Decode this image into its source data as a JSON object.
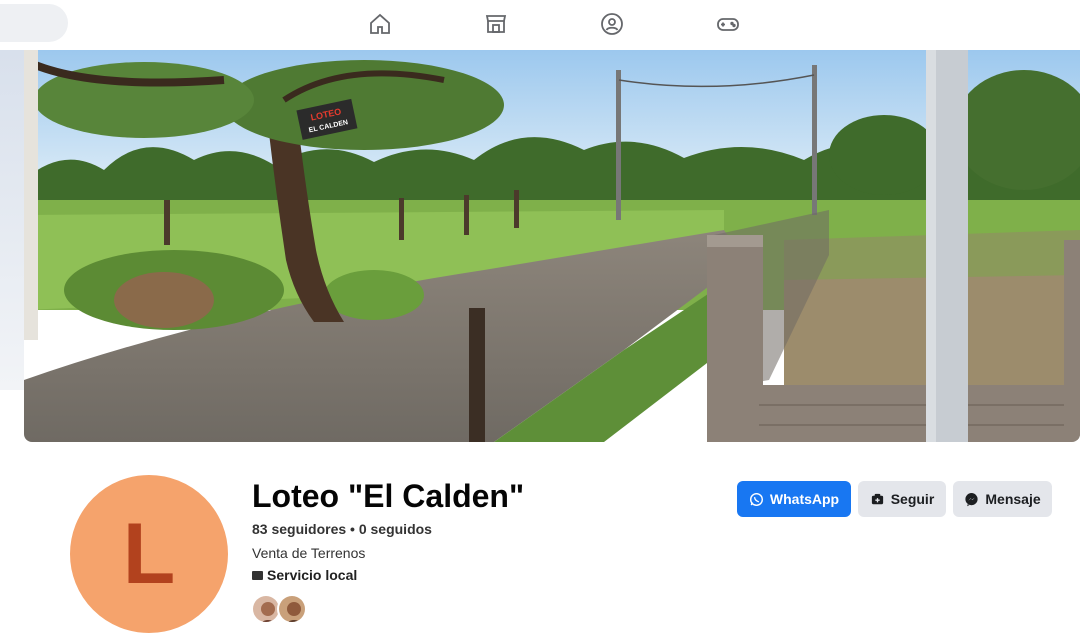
{
  "nav": {
    "items": [
      {
        "icon": "home-icon"
      },
      {
        "icon": "marketplace-icon"
      },
      {
        "icon": "groups-icon"
      },
      {
        "icon": "gaming-icon"
      }
    ]
  },
  "cover": {
    "sign_text_line1": "LOTEO",
    "sign_text_line2": "EL CALDEN"
  },
  "profile": {
    "avatar_letter": "L",
    "avatar_color": "#f5a36c",
    "avatar_letter_color": "#b2421e",
    "name": "Loteo \"El Calden\"",
    "stats": "83 seguidores • 0 seguidos",
    "category": "Venta de Terrenos",
    "service": "Servicio local"
  },
  "actions": {
    "whatsapp_label": "WhatsApp",
    "follow_label": "Seguir",
    "message_label": "Mensaje",
    "primary_color": "#1877f2"
  }
}
